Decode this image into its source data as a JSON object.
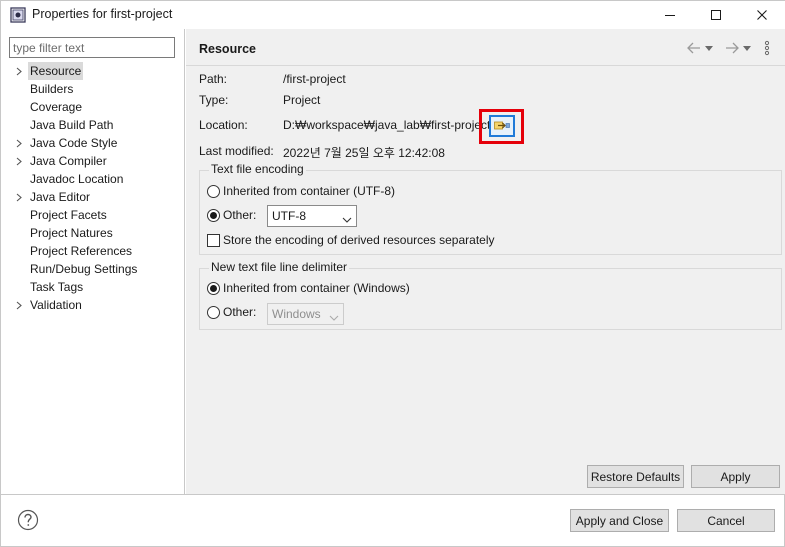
{
  "window": {
    "title": "Properties for first-project"
  },
  "filter": {
    "placeholder": "type filter text"
  },
  "tree": {
    "items": [
      {
        "label": "Resource",
        "expandable": true,
        "selected": true
      },
      {
        "label": "Builders",
        "expandable": false
      },
      {
        "label": "Coverage",
        "expandable": false
      },
      {
        "label": "Java Build Path",
        "expandable": false
      },
      {
        "label": "Java Code Style",
        "expandable": true
      },
      {
        "label": "Java Compiler",
        "expandable": true
      },
      {
        "label": "Javadoc Location",
        "expandable": false
      },
      {
        "label": "Java Editor",
        "expandable": true
      },
      {
        "label": "Project Facets",
        "expandable": false
      },
      {
        "label": "Project Natures",
        "expandable": false
      },
      {
        "label": "Project References",
        "expandable": false
      },
      {
        "label": "Run/Debug Settings",
        "expandable": false
      },
      {
        "label": "Task Tags",
        "expandable": false
      },
      {
        "label": "Validation",
        "expandable": true
      }
    ]
  },
  "page": {
    "title": "Resource",
    "path_label": "Path:",
    "path_value": "/first-project",
    "type_label": "Type:",
    "type_value": "Project",
    "location_label": "Location:",
    "location_value": "D:₩workspace₩java_lab₩first-project",
    "modified_label": "Last modified:",
    "modified_value": "2022년 7월 25일 오후 12:42:08"
  },
  "encoding": {
    "title": "Text file encoding",
    "inherited_label": "Inherited from container (UTF-8)",
    "other_label": "Other:",
    "other_value": "UTF-8",
    "derived_label": "Store the encoding of derived resources separately"
  },
  "delimiter": {
    "title": "New text file line delimiter",
    "inherited_label": "Inherited from container (Windows)",
    "other_label": "Other:",
    "other_value": "Windows"
  },
  "buttons": {
    "restore_defaults": "Restore Defaults",
    "apply": "Apply",
    "apply_and_close": "Apply and Close",
    "cancel": "Cancel"
  },
  "colors": {
    "highlight": "#e5000a",
    "focus": "#1f7ad8",
    "selection": "#dadada"
  }
}
